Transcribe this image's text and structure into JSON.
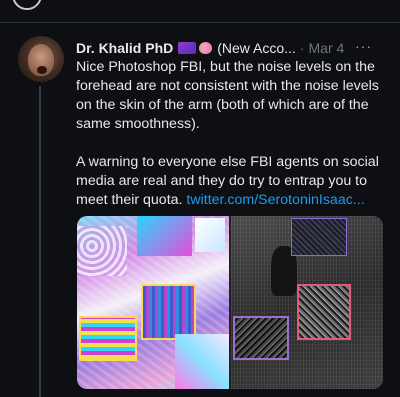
{
  "tweet": {
    "display_name": "Dr. Khalid PhD",
    "handle": "(New Acco...",
    "separator": "·",
    "date": "Mar 4",
    "more": "···",
    "paragraph1": "Nice Photoshop FBI, but the noise levels on the forehead are not consistent with the noise levels on the skin of the arm (both of which are of the same smoothness).",
    "paragraph2_text": "A warning to everyone else FBI agents on social media are real and they do try to entrap you to meet their quota.",
    "paragraph2_link": "twitter.com/SerotoninIsaac..."
  },
  "icons": [
    "purple-flag-emoji-icon",
    "brain-emoji-icon",
    "more-options-icon"
  ],
  "colors": {
    "background": "#0d0f12",
    "text": "#e7e9ea",
    "muted": "#71767b",
    "link": "#1d9bf0"
  }
}
